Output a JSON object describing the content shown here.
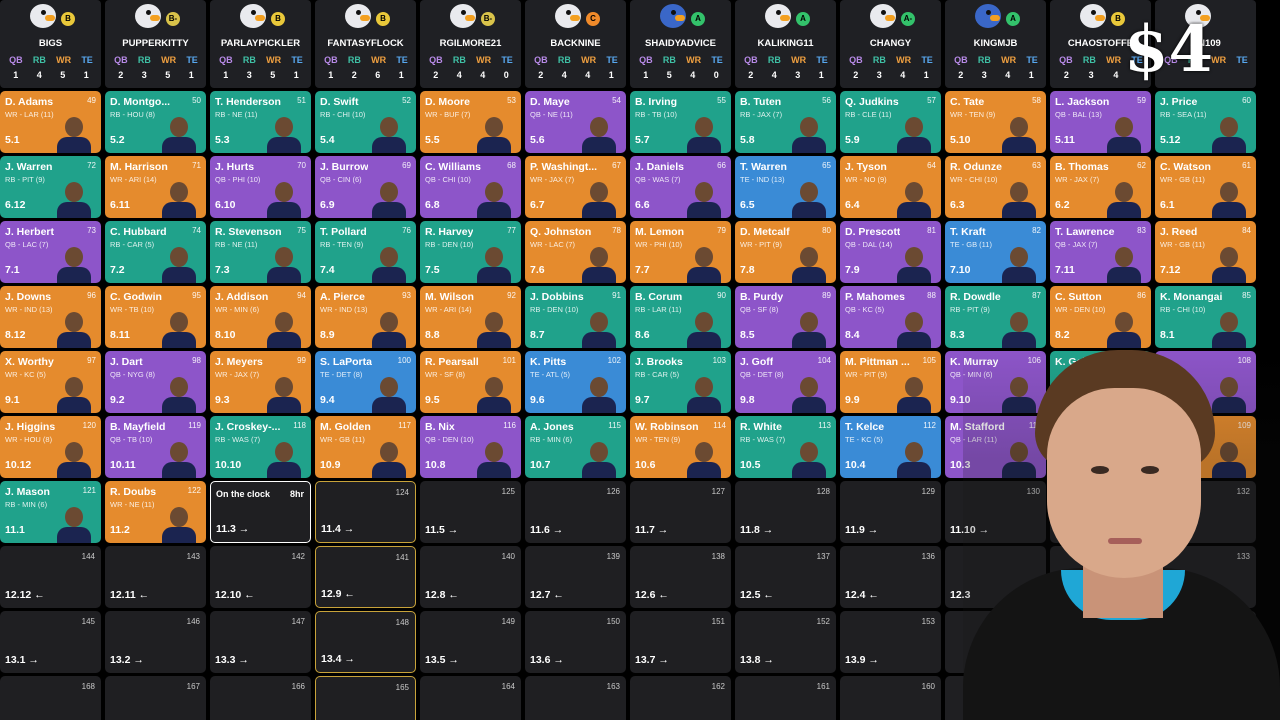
{
  "price_overlay": "$4",
  "position_labels": [
    "QB",
    "RB",
    "WR",
    "TE"
  ],
  "grade_colors": {
    "B": "#e9c83a",
    "B-": "#d9c34a",
    "C": "#f08a2a",
    "A": "#33c26b",
    "A-": "#33c26b"
  },
  "position_colors": {
    "QB": "#8d55c9",
    "RB": "#20a28b",
    "WR": "#e58b2d",
    "TE": "#3a8bd6"
  },
  "teams": [
    {
      "name": "BIGS",
      "grade": "B",
      "avatar": "duck-white",
      "counts": [
        "1",
        "4",
        "5",
        "1"
      ]
    },
    {
      "name": "PUPPERKITTY",
      "grade": "B-",
      "avatar": "duck-white",
      "counts": [
        "2",
        "3",
        "5",
        "1"
      ]
    },
    {
      "name": "PARLAYPICKLER",
      "grade": "B",
      "avatar": "duck-white",
      "counts": [
        "1",
        "3",
        "5",
        "1"
      ]
    },
    {
      "name": "FANTASYFLOCK",
      "grade": "B",
      "avatar": "duck-white",
      "counts": [
        "1",
        "2",
        "6",
        "1"
      ]
    },
    {
      "name": "RGILMORE21",
      "grade": "B-",
      "avatar": "duck-white",
      "counts": [
        "2",
        "4",
        "4",
        "0"
      ]
    },
    {
      "name": "BACKNINE",
      "grade": "C",
      "avatar": "duck-white",
      "counts": [
        "2",
        "4",
        "4",
        "1"
      ]
    },
    {
      "name": "SHAIDYADVICE",
      "grade": "A",
      "avatar": "duck-blue",
      "counts": [
        "1",
        "5",
        "4",
        "0"
      ]
    },
    {
      "name": "KALIKING11",
      "grade": "A",
      "avatar": "duck-white",
      "counts": [
        "2",
        "4",
        "3",
        "1"
      ]
    },
    {
      "name": "CHANGY",
      "grade": "A-",
      "avatar": "duck-white",
      "counts": [
        "2",
        "3",
        "4",
        "1"
      ]
    },
    {
      "name": "KINGMJB",
      "grade": "A",
      "avatar": "duck-blue",
      "counts": [
        "2",
        "3",
        "4",
        "1"
      ]
    },
    {
      "name": "CHAOSTOFFE",
      "grade": "B",
      "avatar": "duck-white",
      "counts": [
        "2",
        "3",
        "4",
        ""
      ]
    },
    {
      "name": "...N109",
      "grade": "",
      "avatar": "duck-white",
      "counts": [
        "",
        "",
        "",
        ""
      ]
    }
  ],
  "rows": [
    [
      {
        "name": "D. Adams",
        "team": "WR - LAR (11)",
        "pick": "49",
        "round": "5.1",
        "pos": "WR"
      },
      {
        "name": "D. Montgo...",
        "team": "RB - HOU (8)",
        "pick": "50",
        "round": "5.2",
        "pos": "RB"
      },
      {
        "name": "T. Henderson",
        "team": "RB - NE (11)",
        "pick": "51",
        "round": "5.3",
        "pos": "RB"
      },
      {
        "name": "D. Swift",
        "team": "RB - CHI (10)",
        "pick": "52",
        "round": "5.4",
        "pos": "RB"
      },
      {
        "name": "D. Moore",
        "team": "WR - BUF (7)",
        "pick": "53",
        "round": "5.5",
        "pos": "WR"
      },
      {
        "name": "D. Maye",
        "team": "QB - NE (11)",
        "pick": "54",
        "round": "5.6",
        "pos": "QB"
      },
      {
        "name": "B. Irving",
        "team": "RB - TB (10)",
        "pick": "55",
        "round": "5.7",
        "pos": "RB"
      },
      {
        "name": "B. Tuten",
        "team": "RB - JAX (7)",
        "pick": "56",
        "round": "5.8",
        "pos": "RB"
      },
      {
        "name": "Q. Judkins",
        "team": "RB - CLE (11)",
        "pick": "57",
        "round": "5.9",
        "pos": "RB"
      },
      {
        "name": "C. Tate",
        "team": "WR - TEN (9)",
        "pick": "58",
        "round": "5.10",
        "pos": "WR"
      },
      {
        "name": "L. Jackson",
        "team": "QB - BAL (13)",
        "pick": "59",
        "round": "5.11",
        "pos": "QB"
      },
      {
        "name": "J. Price",
        "team": "RB - SEA (11)",
        "pick": "60",
        "round": "5.12",
        "pos": "RB"
      }
    ],
    [
      {
        "name": "J. Warren",
        "team": "RB - PIT (9)",
        "pick": "72",
        "round": "6.12",
        "pos": "RB"
      },
      {
        "name": "M. Harrison",
        "team": "WR - ARI (14)",
        "pick": "71",
        "round": "6.11",
        "pos": "WR"
      },
      {
        "name": "J. Hurts",
        "team": "QB - PHI (10)",
        "pick": "70",
        "round": "6.10",
        "pos": "QB"
      },
      {
        "name": "J. Burrow",
        "team": "QB - CIN (6)",
        "pick": "69",
        "round": "6.9",
        "pos": "QB"
      },
      {
        "name": "C. Williams",
        "team": "QB - CHI (10)",
        "pick": "68",
        "round": "6.8",
        "pos": "QB"
      },
      {
        "name": "P. Washingt...",
        "team": "WR - JAX (7)",
        "pick": "67",
        "round": "6.7",
        "pos": "WR"
      },
      {
        "name": "J. Daniels",
        "team": "QB - WAS (7)",
        "pick": "66",
        "round": "6.6",
        "pos": "QB"
      },
      {
        "name": "T. Warren",
        "team": "TE - IND (13)",
        "pick": "65",
        "round": "6.5",
        "pos": "TE"
      },
      {
        "name": "J. Tyson",
        "team": "WR - NO (9)",
        "pick": "64",
        "round": "6.4",
        "pos": "WR"
      },
      {
        "name": "R. Odunze",
        "team": "WR - CHI (10)",
        "pick": "63",
        "round": "6.3",
        "pos": "WR"
      },
      {
        "name": "B. Thomas",
        "team": "WR - JAX (7)",
        "pick": "62",
        "round": "6.2",
        "pos": "WR"
      },
      {
        "name": "C. Watson",
        "team": "WR - GB (11)",
        "pick": "61",
        "round": "6.1",
        "pos": "WR"
      }
    ],
    [
      {
        "name": "J. Herbert",
        "team": "QB - LAC (7)",
        "pick": "73",
        "round": "7.1",
        "pos": "QB"
      },
      {
        "name": "C. Hubbard",
        "team": "RB - CAR (5)",
        "pick": "74",
        "round": "7.2",
        "pos": "RB"
      },
      {
        "name": "R. Stevenson",
        "team": "RB - NE (11)",
        "pick": "75",
        "round": "7.3",
        "pos": "RB"
      },
      {
        "name": "T. Pollard",
        "team": "RB - TEN (9)",
        "pick": "76",
        "round": "7.4",
        "pos": "RB"
      },
      {
        "name": "R. Harvey",
        "team": "RB - DEN (10)",
        "pick": "77",
        "round": "7.5",
        "pos": "RB"
      },
      {
        "name": "Q. Johnston",
        "team": "WR - LAC (7)",
        "pick": "78",
        "round": "7.6",
        "pos": "WR"
      },
      {
        "name": "M. Lemon",
        "team": "WR - PHI (10)",
        "pick": "79",
        "round": "7.7",
        "pos": "WR"
      },
      {
        "name": "D. Metcalf",
        "team": "WR - PIT (9)",
        "pick": "80",
        "round": "7.8",
        "pos": "WR"
      },
      {
        "name": "D. Prescott",
        "team": "QB - DAL (14)",
        "pick": "81",
        "round": "7.9",
        "pos": "QB"
      },
      {
        "name": "T. Kraft",
        "team": "TE - GB (11)",
        "pick": "82",
        "round": "7.10",
        "pos": "TE"
      },
      {
        "name": "T. Lawrence",
        "team": "QB - JAX (7)",
        "pick": "83",
        "round": "7.11",
        "pos": "QB"
      },
      {
        "name": "J. Reed",
        "team": "WR - GB (11)",
        "pick": "84",
        "round": "7.12",
        "pos": "WR"
      }
    ],
    [
      {
        "name": "J. Downs",
        "team": "WR - IND (13)",
        "pick": "96",
        "round": "8.12",
        "pos": "WR"
      },
      {
        "name": "C. Godwin",
        "team": "WR - TB (10)",
        "pick": "95",
        "round": "8.11",
        "pos": "WR"
      },
      {
        "name": "J. Addison",
        "team": "WR - MIN (6)",
        "pick": "94",
        "round": "8.10",
        "pos": "WR"
      },
      {
        "name": "A. Pierce",
        "team": "WR - IND (13)",
        "pick": "93",
        "round": "8.9",
        "pos": "WR"
      },
      {
        "name": "M. Wilson",
        "team": "WR - ARI (14)",
        "pick": "92",
        "round": "8.8",
        "pos": "WR"
      },
      {
        "name": "J. Dobbins",
        "team": "RB - DEN (10)",
        "pick": "91",
        "round": "8.7",
        "pos": "RB"
      },
      {
        "name": "B. Corum",
        "team": "RB - LAR (11)",
        "pick": "90",
        "round": "8.6",
        "pos": "RB"
      },
      {
        "name": "B. Purdy",
        "team": "QB - SF (8)",
        "pick": "89",
        "round": "8.5",
        "pos": "QB"
      },
      {
        "name": "P. Mahomes",
        "team": "QB - KC (5)",
        "pick": "88",
        "round": "8.4",
        "pos": "QB"
      },
      {
        "name": "R. Dowdle",
        "team": "RB - PIT (9)",
        "pick": "87",
        "round": "8.3",
        "pos": "RB"
      },
      {
        "name": "C. Sutton",
        "team": "WR - DEN (10)",
        "pick": "86",
        "round": "8.2",
        "pos": "WR"
      },
      {
        "name": "K. Monangai",
        "team": "RB - CHI (10)",
        "pick": "85",
        "round": "8.1",
        "pos": "RB"
      }
    ],
    [
      {
        "name": "X. Worthy",
        "team": "WR - KC (5)",
        "pick": "97",
        "round": "9.1",
        "pos": "WR"
      },
      {
        "name": "J. Dart",
        "team": "QB - NYG (8)",
        "pick": "98",
        "round": "9.2",
        "pos": "QB"
      },
      {
        "name": "J. Meyers",
        "team": "WR - JAX (7)",
        "pick": "99",
        "round": "9.3",
        "pos": "WR"
      },
      {
        "name": "S. LaPorta",
        "team": "TE - DET (8)",
        "pick": "100",
        "round": "9.4",
        "pos": "TE"
      },
      {
        "name": "R. Pearsall",
        "team": "WR - SF (8)",
        "pick": "101",
        "round": "9.5",
        "pos": "WR"
      },
      {
        "name": "K. Pitts",
        "team": "TE - ATL (5)",
        "pick": "102",
        "round": "9.6",
        "pos": "TE"
      },
      {
        "name": "J. Brooks",
        "team": "RB - CAR (5)",
        "pick": "103",
        "round": "9.7",
        "pos": "RB"
      },
      {
        "name": "J. Goff",
        "team": "QB - DET (8)",
        "pick": "104",
        "round": "9.8",
        "pos": "QB"
      },
      {
        "name": "M. Pittman ...",
        "team": "WR - PIT (9)",
        "pick": "105",
        "round": "9.9",
        "pos": "WR"
      },
      {
        "name": "K. Murray",
        "team": "QB - MIN (6)",
        "pick": "106",
        "round": "9.10",
        "pos": "QB"
      },
      {
        "name": "K. Gain...",
        "team": "",
        "pick": "",
        "round": "",
        "pos": "RB"
      },
      {
        "name": "",
        "team": "",
        "pick": "108",
        "round": "",
        "pos": "QB"
      }
    ],
    [
      {
        "name": "J. Higgins",
        "team": "WR - HOU (8)",
        "pick": "120",
        "round": "10.12",
        "pos": "WR"
      },
      {
        "name": "B. Mayfield",
        "team": "QB - TB (10)",
        "pick": "119",
        "round": "10.11",
        "pos": "QB"
      },
      {
        "name": "J. Croskey-...",
        "team": "RB - WAS (7)",
        "pick": "118",
        "round": "10.10",
        "pos": "RB"
      },
      {
        "name": "M. Golden",
        "team": "WR - GB (11)",
        "pick": "117",
        "round": "10.9",
        "pos": "WR"
      },
      {
        "name": "B. Nix",
        "team": "QB - DEN (10)",
        "pick": "116",
        "round": "10.8",
        "pos": "QB"
      },
      {
        "name": "A. Jones",
        "team": "RB - MIN (6)",
        "pick": "115",
        "round": "10.7",
        "pos": "RB"
      },
      {
        "name": "W. Robinson",
        "team": "WR - TEN (9)",
        "pick": "114",
        "round": "10.6",
        "pos": "WR"
      },
      {
        "name": "R. White",
        "team": "RB - WAS (7)",
        "pick": "113",
        "round": "10.5",
        "pos": "RB"
      },
      {
        "name": "T. Kelce",
        "team": "TE - KC (5)",
        "pick": "112",
        "round": "10.4",
        "pos": "TE"
      },
      {
        "name": "M. Stafford",
        "team": "QB - LAR (11)",
        "pick": "111",
        "round": "10.3",
        "pos": "QB"
      },
      {
        "name": "",
        "team": "",
        "pick": "",
        "round": "",
        "pos": "QB"
      },
      {
        "name": "",
        "team": "",
        "pick": "109",
        "round": "",
        "pos": "WR"
      }
    ]
  ],
  "row7": [
    {
      "kind": "pick",
      "name": "J. Mason",
      "team": "RB - MIN (6)",
      "pick": "121",
      "round": "11.1",
      "pos": "RB"
    },
    {
      "kind": "pick",
      "name": "R. Doubs",
      "team": "WR - NE (11)",
      "pick": "122",
      "round": "11.2",
      "pos": "WR"
    },
    {
      "kind": "clock",
      "label": "On the clock",
      "time": "8hr",
      "round": "11.3 →"
    },
    {
      "kind": "gold",
      "pick": "124",
      "round": "11.4 →"
    },
    {
      "kind": "empty",
      "pick": "125",
      "round": "11.5 →"
    },
    {
      "kind": "empty",
      "pick": "126",
      "round": "11.6 →"
    },
    {
      "kind": "empty",
      "pick": "127",
      "round": "11.7 →"
    },
    {
      "kind": "empty",
      "pick": "128",
      "round": "11.8 →"
    },
    {
      "kind": "empty",
      "pick": "129",
      "round": "11.9 →"
    },
    {
      "kind": "empty",
      "pick": "130",
      "round": "11.10 →"
    },
    {
      "kind": "empty",
      "pick": "",
      "round": ""
    },
    {
      "kind": "empty",
      "pick": "132",
      "round": ""
    }
  ],
  "row8": [
    {
      "kind": "empty",
      "pick": "144",
      "round": "12.12 ←"
    },
    {
      "kind": "empty",
      "pick": "143",
      "round": "12.11 ←"
    },
    {
      "kind": "empty",
      "pick": "142",
      "round": "12.10 ←"
    },
    {
      "kind": "gold",
      "pick": "141",
      "round": "12.9 ←"
    },
    {
      "kind": "empty",
      "pick": "140",
      "round": "12.8 ←"
    },
    {
      "kind": "empty",
      "pick": "139",
      "round": "12.7 ←"
    },
    {
      "kind": "empty",
      "pick": "138",
      "round": "12.6 ←"
    },
    {
      "kind": "empty",
      "pick": "137",
      "round": "12.5 ←"
    },
    {
      "kind": "empty",
      "pick": "136",
      "round": "12.4 ←"
    },
    {
      "kind": "empty",
      "pick": "",
      "round": "12.3"
    },
    {
      "kind": "empty",
      "pick": "",
      "round": ""
    },
    {
      "kind": "empty",
      "pick": "133",
      "round": ""
    }
  ],
  "row9": [
    {
      "kind": "empty",
      "pick": "145",
      "round": "13.1 →"
    },
    {
      "kind": "empty",
      "pick": "146",
      "round": "13.2 →"
    },
    {
      "kind": "empty",
      "pick": "147",
      "round": "13.3 →"
    },
    {
      "kind": "gold",
      "pick": "148",
      "round": "13.4 →"
    },
    {
      "kind": "empty",
      "pick": "149",
      "round": "13.5 →"
    },
    {
      "kind": "empty",
      "pick": "150",
      "round": "13.6 →"
    },
    {
      "kind": "empty",
      "pick": "151",
      "round": "13.7 →"
    },
    {
      "kind": "empty",
      "pick": "152",
      "round": "13.8 →"
    },
    {
      "kind": "empty",
      "pick": "153",
      "round": "13.9 →"
    },
    {
      "kind": "empty",
      "pick": "",
      "round": ""
    },
    {
      "kind": "empty",
      "pick": "",
      "round": ""
    },
    {
      "kind": "empty",
      "pick": "",
      "round": ""
    }
  ],
  "row10": [
    {
      "kind": "empty",
      "pick": "168",
      "round": ""
    },
    {
      "kind": "empty",
      "pick": "167",
      "round": ""
    },
    {
      "kind": "empty",
      "pick": "166",
      "round": ""
    },
    {
      "kind": "gold",
      "pick": "165",
      "round": ""
    },
    {
      "kind": "empty",
      "pick": "164",
      "round": ""
    },
    {
      "kind": "empty",
      "pick": "163",
      "round": ""
    },
    {
      "kind": "empty",
      "pick": "162",
      "round": ""
    },
    {
      "kind": "empty",
      "pick": "161",
      "round": ""
    },
    {
      "kind": "empty",
      "pick": "160",
      "round": ""
    },
    {
      "kind": "empty",
      "pick": "",
      "round": ""
    },
    {
      "kind": "empty",
      "pick": "",
      "round": ""
    },
    {
      "kind": "empty",
      "pick": "",
      "round": ""
    }
  ]
}
